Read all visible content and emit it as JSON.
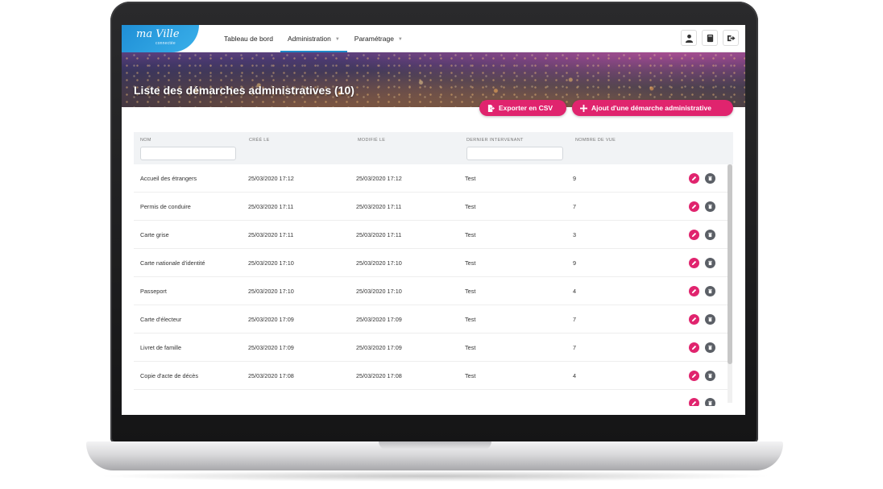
{
  "app": {
    "logo_main": "ma Ville",
    "logo_sub": "connectée"
  },
  "nav": {
    "items": [
      {
        "label": "Tableau de bord",
        "has_caret": false,
        "active": false
      },
      {
        "label": "Administration",
        "has_caret": true,
        "active": true
      },
      {
        "label": "Paramétrage",
        "has_caret": true,
        "active": false
      }
    ],
    "caret": "▼"
  },
  "header_icons": [
    "user-icon",
    "book-icon",
    "logout-icon"
  ],
  "page": {
    "title": "Liste des démarches administratives (10)"
  },
  "actions": {
    "export_label": "Exporter en CSV",
    "add_label": "Ajout d'une démarche administrative"
  },
  "table": {
    "columns": [
      "NOM",
      "CRÉÉ LE",
      "MODIFIÉ LE",
      "DERNIER INTERVENANT",
      "NOMBRE DE VUE"
    ],
    "filters": {
      "nom": "",
      "dernier_intervenant": ""
    },
    "rows": [
      {
        "nom": "Accueil des étrangers",
        "cree": "25/03/2020 17:12",
        "modifie": "25/03/2020 17:12",
        "intervenant": "Test",
        "vues": "9"
      },
      {
        "nom": "Permis de conduire",
        "cree": "25/03/2020 17:11",
        "modifie": "25/03/2020 17:11",
        "intervenant": "Test",
        "vues": "7"
      },
      {
        "nom": "Carte grise",
        "cree": "25/03/2020 17:11",
        "modifie": "25/03/2020 17:11",
        "intervenant": "Test",
        "vues": "3"
      },
      {
        "nom": "Carte nationale d'identité",
        "cree": "25/03/2020 17:10",
        "modifie": "25/03/2020 17:10",
        "intervenant": "Test",
        "vues": "9"
      },
      {
        "nom": "Passeport",
        "cree": "25/03/2020 17:10",
        "modifie": "25/03/2020 17:10",
        "intervenant": "Test",
        "vues": "4"
      },
      {
        "nom": "Carte d'électeur",
        "cree": "25/03/2020 17:09",
        "modifie": "25/03/2020 17:09",
        "intervenant": "Test",
        "vues": "7"
      },
      {
        "nom": "Livret de famille",
        "cree": "25/03/2020 17:09",
        "modifie": "25/03/2020 17:09",
        "intervenant": "Test",
        "vues": "7"
      },
      {
        "nom": "Copie d'acte de décès",
        "cree": "25/03/2020 17:08",
        "modifie": "25/03/2020 17:08",
        "intervenant": "Test",
        "vues": "4"
      }
    ],
    "row_action_icons": [
      "pencil-icon",
      "trash-icon"
    ]
  },
  "colors": {
    "accent_pink": "#e0246e",
    "brand_blue": "#1e88c8",
    "delete_gray": "#5b5f66"
  }
}
